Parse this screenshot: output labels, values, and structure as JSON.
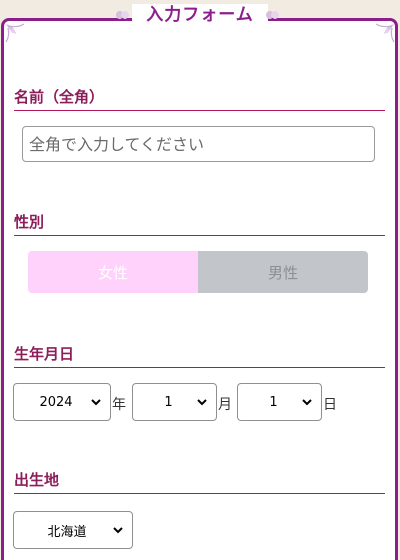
{
  "form": {
    "title": "入力フォーム"
  },
  "name_section": {
    "label": "名前（全角）",
    "input_placeholder": "全角で入力してください",
    "input_value": ""
  },
  "gender_section": {
    "label": "性別",
    "options": [
      "女性",
      "男性"
    ],
    "selected": "女性"
  },
  "birthdate_section": {
    "label": "生年月日",
    "year_value": "2024",
    "year_unit": "年",
    "month_value": "1",
    "month_unit": "月",
    "day_value": "1",
    "day_unit": "日"
  },
  "birthplace_section": {
    "label": "出生地",
    "selected": "北海道"
  },
  "colors": {
    "frame": "#8c1e8c",
    "heading": "#8c1e5a",
    "heading_rule": "#b0175a",
    "female_bg": "#ffd2fc",
    "male_bg": "#c2c6cb"
  }
}
